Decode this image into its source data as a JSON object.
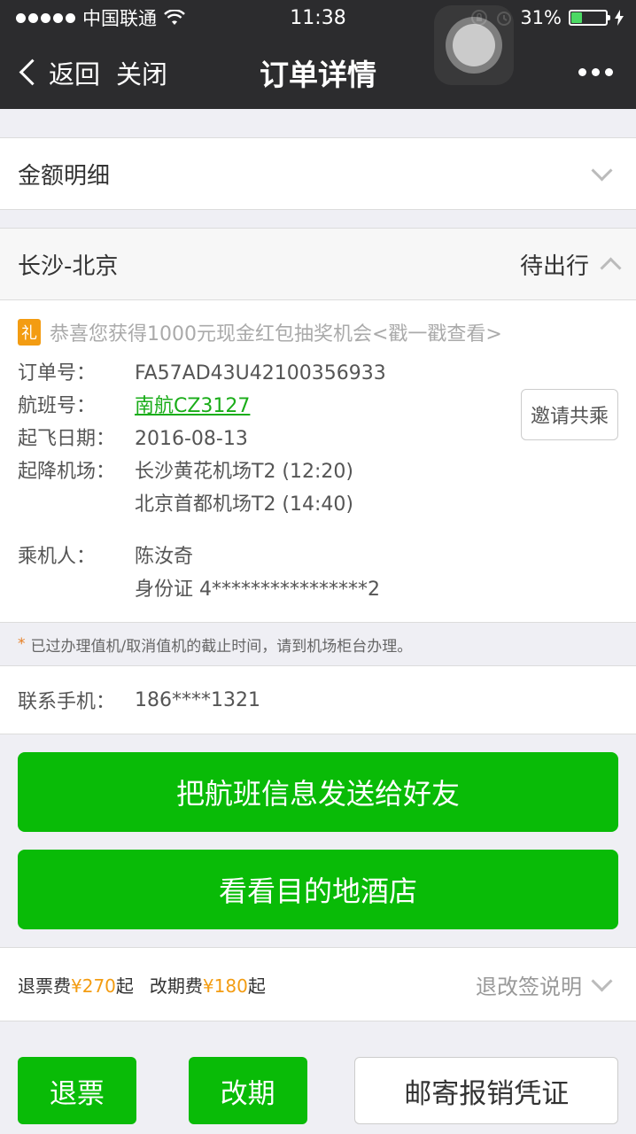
{
  "status_bar": {
    "carrier": "中国联通",
    "time": "11:38",
    "battery": "31%",
    "battery_level": 0.31
  },
  "nav": {
    "back_label": "返回",
    "close_label": "关闭",
    "title": "订单详情"
  },
  "amount": {
    "label": "金额明细"
  },
  "route": {
    "name": "长沙-北京",
    "status": "待出行"
  },
  "promo": {
    "icon_text": "礼",
    "text": "恭喜您获得1000元现金红包抽奖机会<戳一戳查看>"
  },
  "order": {
    "order_no_label": "订单号：",
    "order_no": "FA57AD43U42100356933",
    "flight_label": "航班号：",
    "flight": "南航CZ3127",
    "date_label": "起飞日期：",
    "date": "2016-08-13",
    "airport_label": "起降机场：",
    "departure_airport": "长沙黄花机场T2 (12:20)",
    "arrival_airport": "北京首都机场T2 (14:40)",
    "passenger_label": "乘机人：",
    "passenger": "陈汝奇",
    "id_card": "身份证 4****************2",
    "invite_button": "邀请共乘"
  },
  "notice": {
    "star": "*",
    "text": "已过办理值机/取消值机的截止时间，请到机场柜台办理。"
  },
  "contact": {
    "label": "联系手机：",
    "phone": "186****1321"
  },
  "buttons": {
    "share_flight": "把航班信息发送给好友",
    "hotel": "看看目的地酒店"
  },
  "fees": {
    "refund_label": "退票费",
    "refund_amount": "¥270",
    "refund_suffix": "起",
    "change_label": "改期费",
    "change_amount": "¥180",
    "change_suffix": "起",
    "policy_label": "退改签说明"
  },
  "bottom": {
    "refund": "退票",
    "reschedule": "改期",
    "invoice": "邮寄报销凭证"
  }
}
